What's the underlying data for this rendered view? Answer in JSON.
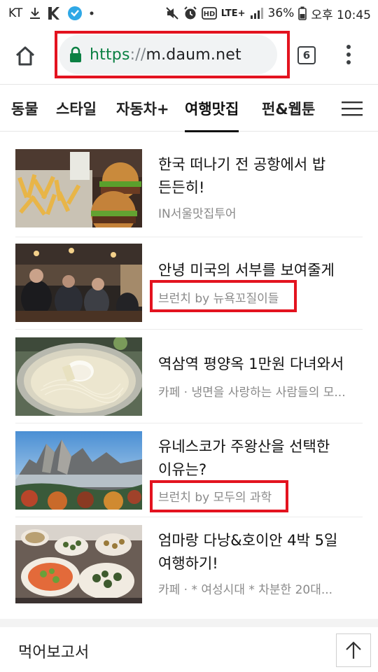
{
  "status_bar": {
    "carrier": "KT",
    "battery": "36%",
    "time": "오후 10:45",
    "network": "LTE+",
    "icons": [
      "download-icon",
      "k-app-icon",
      "messenger-icon",
      "dot-icon",
      "mute-icon",
      "alarm-icon",
      "hd-icon",
      "lte-icon",
      "signal-icon",
      "battery-icon"
    ]
  },
  "browser": {
    "url_scheme": "https",
    "url_sep": "://",
    "url_host": "m.daum.net",
    "tab_count": "6",
    "icons": [
      "home-icon",
      "lock-icon",
      "more-vert-icon"
    ]
  },
  "nav": {
    "tabs": [
      {
        "label": "동물"
      },
      {
        "label": "스타일"
      },
      {
        "label": "자동차+"
      },
      {
        "label": "여행맛집",
        "active": true
      },
      {
        "label": "펀&웹툰"
      }
    ],
    "menu_icon": "hamburger-icon"
  },
  "articles": [
    {
      "title": "한국 떠나기 전 공항에서 밥 든든히!",
      "source": "IN서울맛집투어",
      "image": "burger-fries-photo"
    },
    {
      "title": "안녕 미국의 서부를 보여줄게",
      "source": "브런치 by 뉴욕꼬질이들",
      "image": "bar-interior-photo"
    },
    {
      "title": "역삼역 평양옥 1만원 다녀와서",
      "source": "카페 · 냉면을 사랑하는 사람들의 모...",
      "image": "naengmyeon-photo"
    },
    {
      "title": "유네스코가 주왕산을 선택한 이유는?",
      "source": "브런치 by 모두의 과학",
      "image": "mountain-photo"
    },
    {
      "title": "엄마랑 다낭&호이안 4박 5일 여행하기!",
      "source": "카페 · * 여성시대 * 차분한 20대...",
      "image": "food-table-photo"
    }
  ],
  "section": {
    "title": "먹어보고서"
  },
  "colors": {
    "highlight": "#e3131f",
    "url_scheme": "#0b8043",
    "lock": "#0b8043",
    "source_text": "#8a8a8a"
  }
}
